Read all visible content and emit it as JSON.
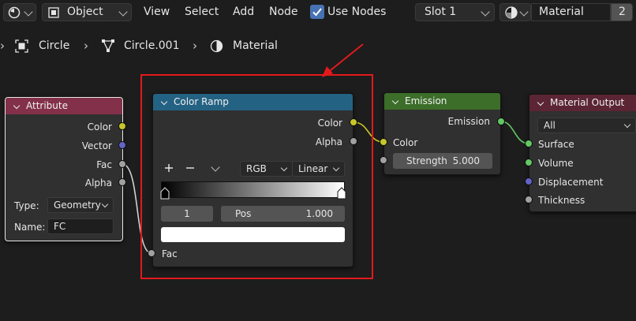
{
  "header": {
    "mode": "Object",
    "menus": [
      "View",
      "Select",
      "Add",
      "Node"
    ],
    "use_nodes_label": "Use Nodes",
    "use_nodes_checked": true,
    "slot": "Slot 1",
    "material_name": "Material",
    "user_count": "2"
  },
  "breadcrumb": [
    "Circle",
    "Circle.001",
    "Material"
  ],
  "nodes": {
    "attribute": {
      "title": "Attribute",
      "outputs": [
        "Color",
        "Vector",
        "Fac",
        "Alpha"
      ],
      "type_label": "Type:",
      "type_value": "Geometry",
      "name_label": "Name:",
      "name_value": "FC"
    },
    "color_ramp": {
      "title": "Color Ramp",
      "outputs": [
        "Color",
        "Alpha"
      ],
      "color_mode": "RGB",
      "interpolation": "Linear",
      "stop_index": "1",
      "pos_label": "Pos",
      "pos_value": "1.000",
      "input": "Fac"
    },
    "emission": {
      "title": "Emission",
      "output": "Emission",
      "input_color": "Color",
      "strength_label": "Strength",
      "strength_value": "5.000"
    },
    "material_output": {
      "title": "Material Output",
      "target": "All",
      "inputs": [
        "Surface",
        "Volume",
        "Displacement",
        "Thickness"
      ]
    }
  },
  "colors": {
    "attribute_header": "#83314a",
    "color_ramp_header": "#246283",
    "emission_header": "#3c6e2a",
    "material_output_header": "#5b2533",
    "socket_color": "#c7c729",
    "socket_vector": "#6363c7",
    "socket_float": "#a1a1a1",
    "socket_shader": "#63c763",
    "annotation_red": "#e3191b"
  },
  "icons": [
    "editor-type-icon",
    "object-mode-icon",
    "checkbox-icon",
    "material-sphere-icon",
    "object-square-icon",
    "mesh-vertex-icon",
    "plus-icon",
    "minus-icon",
    "chevron-down-icon",
    "arrow-annotation"
  ]
}
